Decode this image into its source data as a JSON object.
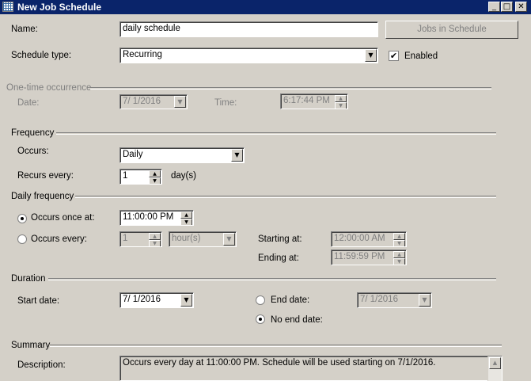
{
  "window": {
    "title": "New Job Schedule",
    "min_glyph": "_",
    "max_glyph": "□",
    "close_glyph": "✕"
  },
  "general": {
    "name_label": "Name:",
    "name_value": "daily schedule",
    "jobs_button": "Jobs in Schedule",
    "type_label": "Schedule type:",
    "type_value": "Recurring",
    "enabled_label": "Enabled",
    "enabled_checked": true
  },
  "one_time": {
    "header": "One-time occurrence",
    "date_label": "Date:",
    "date_value": "7/  1/2016",
    "time_label": "Time:",
    "time_value": "6:17:44 PM"
  },
  "frequency": {
    "header": "Frequency",
    "occurs_label": "Occurs:",
    "occurs_value": "Daily",
    "recurs_label": "Recurs every:",
    "recurs_value": "1",
    "recurs_unit": "day(s)"
  },
  "daily_frequency": {
    "header": "Daily frequency",
    "once_label": "Occurs once at:",
    "once_value": "11:00:00 PM",
    "every_label": "Occurs every:",
    "every_value": "1",
    "every_unit": "hour(s)",
    "starting_label": "Starting at:",
    "starting_value": "12:00:00 AM",
    "ending_label": "Ending at:",
    "ending_value": "11:59:59 PM"
  },
  "duration": {
    "header": "Duration",
    "start_label": "Start date:",
    "start_value": "7/  1/2016",
    "end_label": "End date:",
    "end_value": "7/  1/2016",
    "no_end_label": "No end date:"
  },
  "summary": {
    "header": "Summary",
    "desc_label": "Description:",
    "desc_value": "Occurs every day at 11:00:00 PM. Schedule will be used starting on 7/1/2016."
  },
  "glyphs": {
    "down": "▼",
    "up": "▲"
  }
}
